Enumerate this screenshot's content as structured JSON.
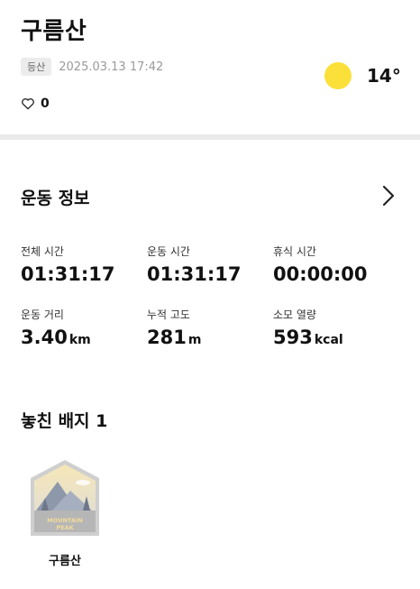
{
  "header": {
    "title": "구름산",
    "category_badge": "등산",
    "datetime": "2025.03.13 17:42",
    "like_count": "0"
  },
  "weather": {
    "temperature": "14°",
    "icon": "sun-icon",
    "sun_color": "#fbe03a"
  },
  "exercise_info": {
    "title": "운동 정보",
    "stats": [
      {
        "label": "전체 시간",
        "value": "01:31:17",
        "unit": ""
      },
      {
        "label": "운동 시간",
        "value": "01:31:17",
        "unit": ""
      },
      {
        "label": "휴식 시간",
        "value": "00:00:00",
        "unit": ""
      },
      {
        "label": "운동 거리",
        "value": "3.40",
        "unit": "km"
      },
      {
        "label": "누적 고도",
        "value": "281",
        "unit": "m"
      },
      {
        "label": "소모 열량",
        "value": "593",
        "unit": "kcal"
      }
    ]
  },
  "missed_badges": {
    "title": "놓친 배지 1",
    "items": [
      {
        "name": "구름산",
        "image_text": "MOUNTAIN PEAK"
      }
    ]
  }
}
